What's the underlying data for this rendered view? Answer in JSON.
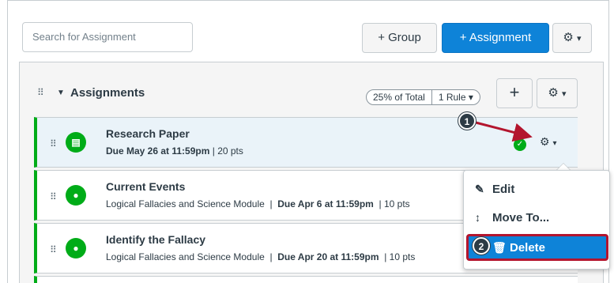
{
  "toolbar": {
    "search_placeholder": "Search for Assignment",
    "group_button": "+ Group",
    "assignment_button": "+ Assignment",
    "settings_caret": "▾"
  },
  "group": {
    "title": "Assignments",
    "weight": "25% of Total",
    "rules": "1 Rule ▾",
    "add_label": "+"
  },
  "assignments": [
    {
      "title": "Research Paper",
      "meta_due": "Due May 26 at 11:59pm",
      "meta_pts": "|  20 pts"
    },
    {
      "title": "Current Events",
      "module": "Logical Fallacies and Science Module",
      "meta_due": "Due Apr 6 at 11:59pm",
      "meta_pts": "|  10 pts"
    },
    {
      "title": "Identify the Fallacy",
      "module": "Logical Fallacies and Science Module",
      "meta_due": "Due Apr 20 at 11:59pm",
      "meta_pts": "|  10 pts"
    }
  ],
  "menu": {
    "edit": "Edit",
    "move": "Move To...",
    "delete": "Delete"
  },
  "callouts": {
    "one": "1",
    "two": "2"
  },
  "colors": {
    "accent_blue": "#0e83d8",
    "published_green": "#00ac18",
    "highlight_red": "#b3152e"
  }
}
